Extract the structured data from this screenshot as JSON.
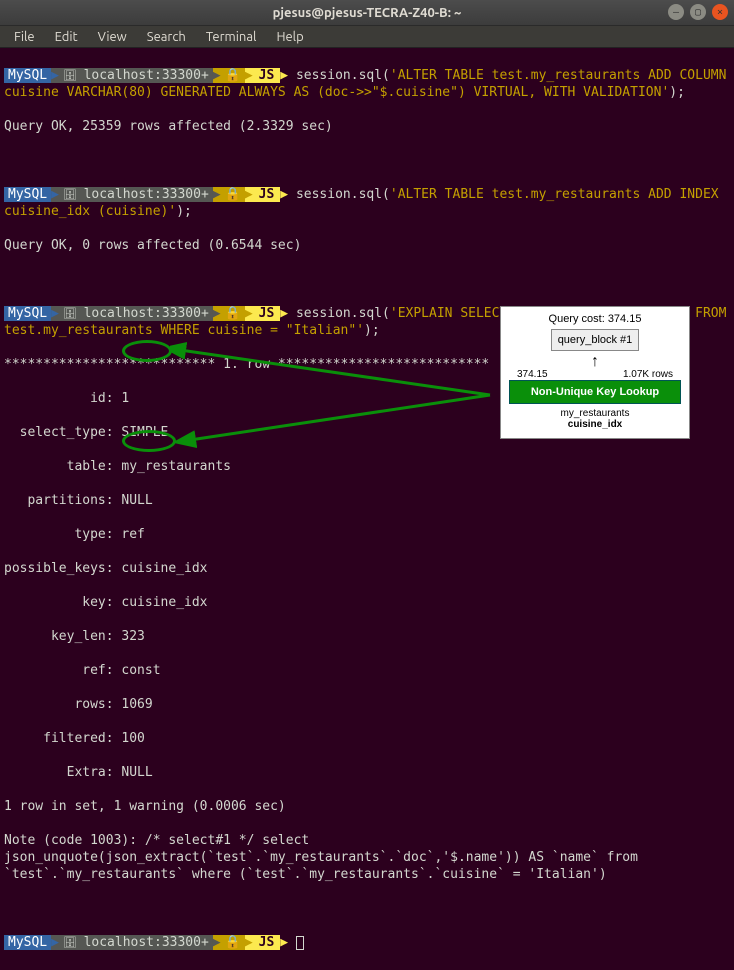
{
  "window": {
    "title": "pjesus@pjesus-TECRA-Z40-B: ~"
  },
  "menu": {
    "file": "File",
    "edit": "Edit",
    "view": "View",
    "search": "Search",
    "terminal": "Terminal",
    "help": "Help"
  },
  "prompt": {
    "mysql": "MySQL",
    "host": "localhost:33300+",
    "js": "JS"
  },
  "block1": {
    "cmd_pre": "session.sql(",
    "cmd_str": "'ALTER TABLE test.my_restaurants ADD COLUMN cuisine VARCHAR(80) GENERATED ALWAYS AS (doc->>\"$.cuisine\") VIRTUAL, WITH VALIDATION'",
    "cmd_post": ");",
    "result": "Query OK, 25359 rows affected (2.3329 sec)"
  },
  "block2": {
    "cmd_pre": "session.sql(",
    "cmd_str": "'ALTER TABLE test.my_restaurants ADD INDEX cuisine_idx (cuisine)'",
    "cmd_post": ");",
    "result": "Query OK, 0 rows affected (0.6544 sec)"
  },
  "block3": {
    "cmd_pre": "session.sql(",
    "cmd_str": "'EXPLAIN SELECT doc->>\"$.name\" AS name FROM test.my_restaurants WHERE cuisine = \"Italian\"'",
    "cmd_post": ");",
    "row_header": "*************************** 1. row ***************************",
    "explain": {
      "id_label": "           id:",
      "id": " 1",
      "select_type_label": "  select_type:",
      "select_type": " SIMPLE",
      "table_label": "        table:",
      "table": " my_restaurants",
      "partitions_label": "   partitions:",
      "partitions": " NULL",
      "type_label": "         type:",
      "type": " ref",
      "possible_keys_label": "possible_keys:",
      "possible_keys": " cuisine_idx",
      "key_label": "          key:",
      "key": " cuisine_idx",
      "key_len_label": "      key_len:",
      "key_len": " 323",
      "ref_label": "          ref:",
      "ref": " const",
      "rows_label": "         rows:",
      "rows": " 1069",
      "filtered_label": "     filtered:",
      "filtered": " 100",
      "extra_label": "        Extra:",
      "extra": " NULL"
    },
    "footer1": "1 row in set, 1 warning (0.0006 sec)",
    "footer2": "Note (code 1003): /* select#1 */ select json_unquote(json_extract(`test`.`my_restaurants`.`doc`,'$.name')) AS `name` from `test`.`my_restaurants` where (`test`.`my_restaurants`.`cuisine` = 'Italian')"
  },
  "popup": {
    "query_cost_label": "Query cost: ",
    "query_cost": "374.15",
    "query_block": "query_block #1",
    "cost_left": "374.15",
    "rows_right": "1.07K rows",
    "lookup": "Non-Unique Key Lookup",
    "table": "my_restaurants",
    "index": "cuisine_idx"
  }
}
